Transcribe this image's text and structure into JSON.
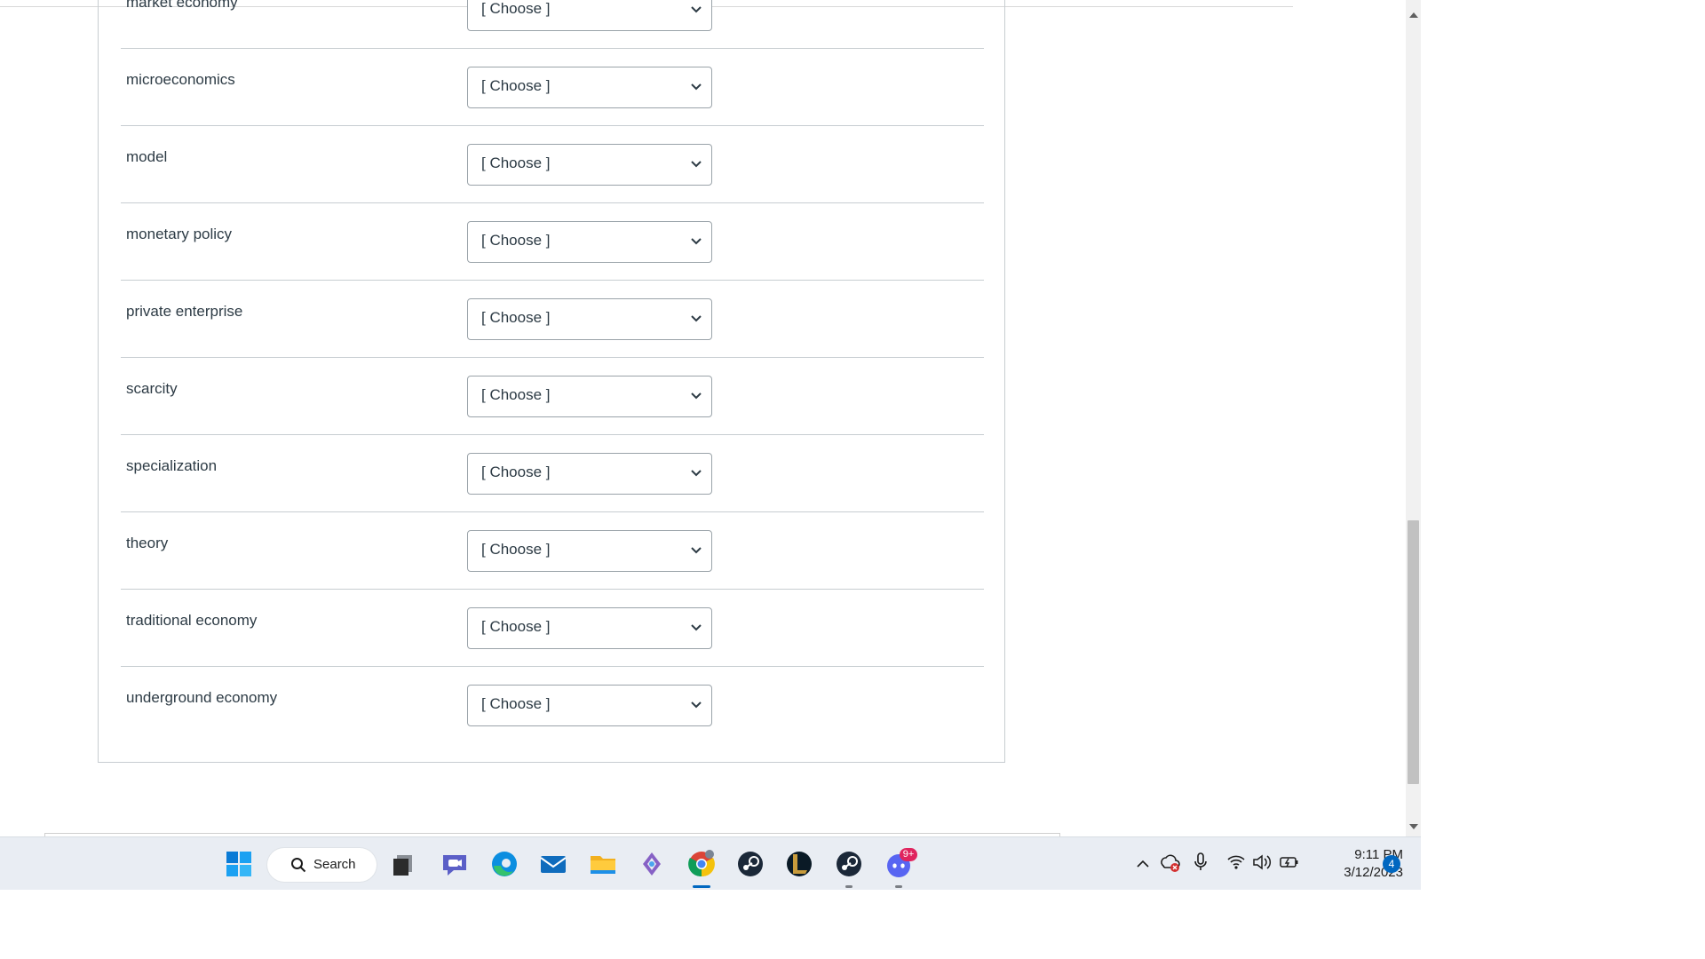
{
  "quiz": {
    "rows": [
      {
        "term": "market economy",
        "selected": "[ Choose ]"
      },
      {
        "term": "microeconomics",
        "selected": "[ Choose ]"
      },
      {
        "term": "model",
        "selected": "[ Choose ]"
      },
      {
        "term": "monetary policy",
        "selected": "[ Choose ]"
      },
      {
        "term": "private enterprise",
        "selected": "[ Choose ]"
      },
      {
        "term": "scarcity",
        "selected": "[ Choose ]"
      },
      {
        "term": "specialization",
        "selected": "[ Choose ]"
      },
      {
        "term": "theory",
        "selected": "[ Choose ]"
      },
      {
        "term": "traditional economy",
        "selected": "[ Choose ]"
      },
      {
        "term": "underground economy",
        "selected": "[ Choose ]"
      }
    ]
  },
  "taskbar": {
    "search_label": "Search",
    "time": "9:11 PM",
    "date": "3/12/2023",
    "notification_count": "4",
    "discord_badge": "9+",
    "icons": [
      "windows-start-icon",
      "search-icon",
      "task-view-icon",
      "teams-chat-icon",
      "edge-icon",
      "mail-icon",
      "file-explorer-icon",
      "copilot-icon",
      "chrome-icon",
      "steam-icon",
      "league-of-legends-icon",
      "steam-icon",
      "discord-icon"
    ]
  },
  "colors": {
    "text": "#2d3b45",
    "border": "#c7cdd1",
    "accent": "#0067c0",
    "taskbar_bg": "#e9edf3"
  }
}
